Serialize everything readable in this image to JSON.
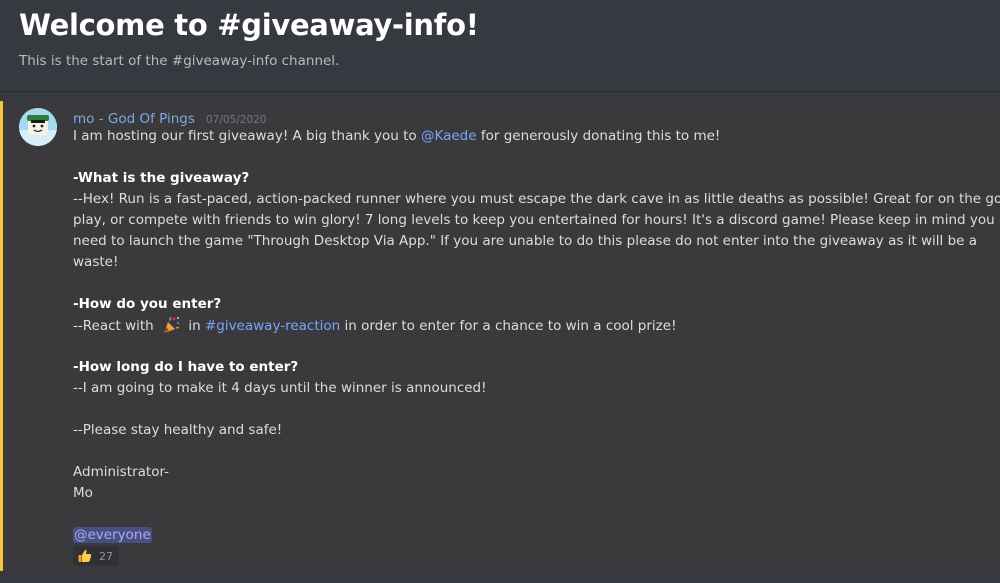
{
  "channel": {
    "welcome_title": "Welcome to #giveaway-info!",
    "welcome_subtitle": "This is the start of the #giveaway-info channel."
  },
  "colors": {
    "background": "#36393f",
    "message_highlight": "#3a3a3c",
    "mention_bar": "#f7c43d",
    "username": "#7ea7e6",
    "mention": "#7ea2ff"
  },
  "message": {
    "author": "mo - God Of Pings",
    "timestamp": "07/05/2020",
    "avatar_icon": "roblox-avatar-icon",
    "intro_pre": "I am hosting our first giveaway! A big thank you to ",
    "intro_mention": "@Kaede",
    "intro_post": " for generously donating this to me!",
    "what_heading": "-What is the giveaway?",
    "what_text": [
      "--Hex! Run is a fast-paced, action-packed runner where you must escape the dark cave in as little deaths as possible! Great for on the go",
      "play, or compete with friends to win glory! 7 long levels to keep you entertained for hours! It's a discord game! Please keep in mind you",
      "need to launch the game \"Through Desktop Via App.\" If you are unable to do this please do not enter into the giveaway as it will be a",
      "waste!"
    ],
    "enter_heading": "-How do you enter?",
    "enter_pre": "--React with ",
    "enter_emoji": "party-popper-icon",
    "enter_mid": " in ",
    "enter_channel": "#giveaway-reaction",
    "enter_post": " in order to enter for a chance to win a cool prize!",
    "duration_heading": "-How long do I have to enter?",
    "duration_text": "--I am going to make it 4 days until the winner is announced!",
    "closing": "--Please stay healthy and safe!",
    "signature_line1": "Administrator-",
    "signature_line2": "Mo",
    "everyone_mention": "@everyone"
  },
  "reaction": {
    "emoji": "thumbs-up-icon",
    "count": "27"
  }
}
